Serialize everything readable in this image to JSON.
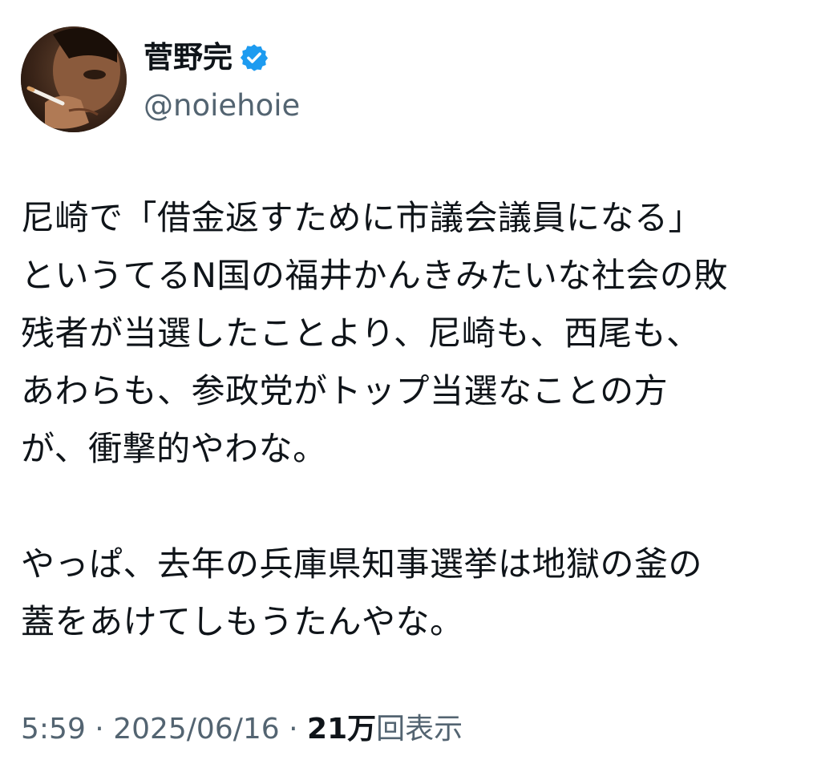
{
  "user": {
    "display_name": "菅野完",
    "handle": "@noiehoie",
    "avatar_icon": "profile-photo-icon",
    "verified_icon": "verified-badge-icon",
    "verified_color": "#1d9bf0"
  },
  "tweet": {
    "paragraph1": [
      "尼崎で「借金返すために市議会議員になる」",
      "というてるN国の福井かんきみたいな社会の敗",
      "残者が当選したことより、尼崎も、西尾も、",
      "あわらも、参政党がトップ当選なことの方",
      "が、衝撃的やわな。"
    ],
    "paragraph2": [
      "やっぱ、去年の兵庫県知事選挙は地獄の釜の",
      "蓋をあけてしもうたんやな。"
    ]
  },
  "meta": {
    "time": "5:59",
    "separator": " · ",
    "date": "2025/06/16",
    "views_count": "21万",
    "views_label": "回表示"
  }
}
